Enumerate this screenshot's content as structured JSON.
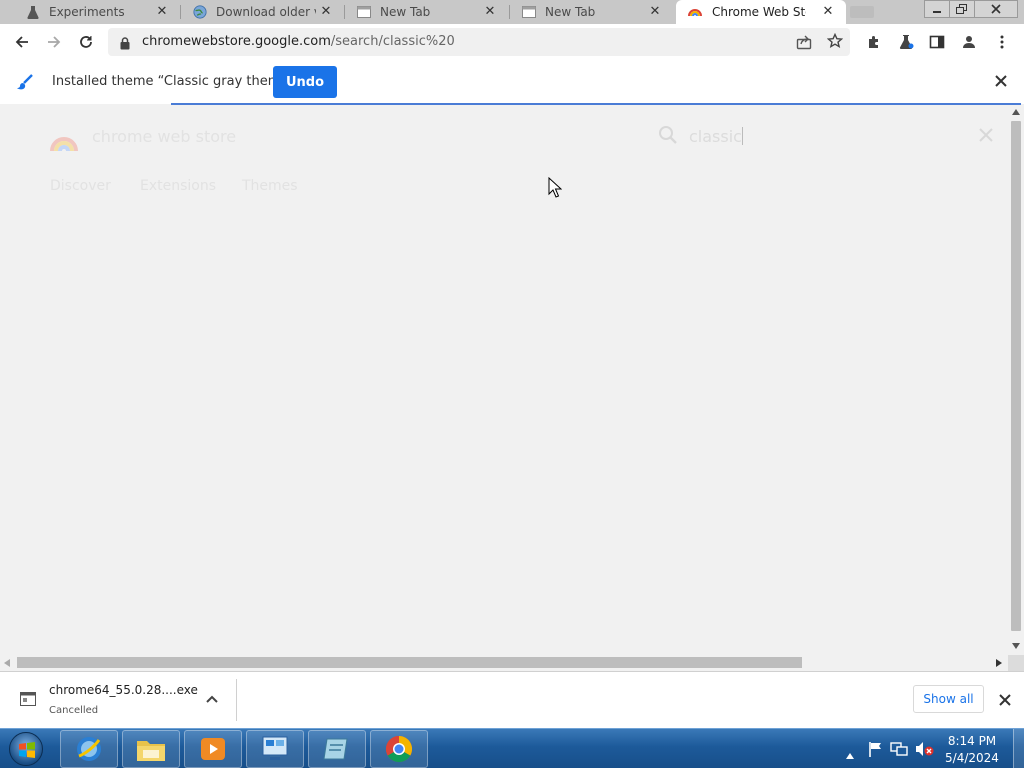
{
  "browser": {
    "tabs": [
      {
        "title": "Experiments",
        "icon": "flask-icon",
        "active": false
      },
      {
        "title": "Download older v",
        "icon": "globe-icon",
        "active": false
      },
      {
        "title": "New Tab",
        "icon": "newtab-icon",
        "active": false
      },
      {
        "title": "New Tab",
        "icon": "newtab-icon",
        "active": false
      },
      {
        "title": "Chrome Web Stor",
        "icon": "webstore-icon",
        "active": true
      }
    ],
    "omnibox": {
      "host": "chromewebstore.google.com",
      "path": "/search/classic%20"
    }
  },
  "infobar": {
    "message": "Installed theme “Classic gray theme”",
    "undo_label": "Undo"
  },
  "webstore": {
    "name": "chrome web store",
    "search_value": "classic",
    "nav": [
      "Discover",
      "Extensions",
      "Themes"
    ]
  },
  "download_shelf": {
    "file_name": "chrome64_55.0.28....exe",
    "status": "Cancelled",
    "show_all_label": "Show all"
  },
  "taskbar": {
    "apps": [
      "internet-explorer-icon",
      "file-explorer-icon",
      "media-player-icon",
      "network-app-icon",
      "notes-app-icon",
      "chrome-icon"
    ],
    "time": "8:14 PM",
    "date": "5/4/2024"
  },
  "colors": {
    "accent": "#1a73e8",
    "infobar_line": "#4a7cd6",
    "tabstrip": "#c8c8c8",
    "taskbar": "#1d5a9a"
  }
}
